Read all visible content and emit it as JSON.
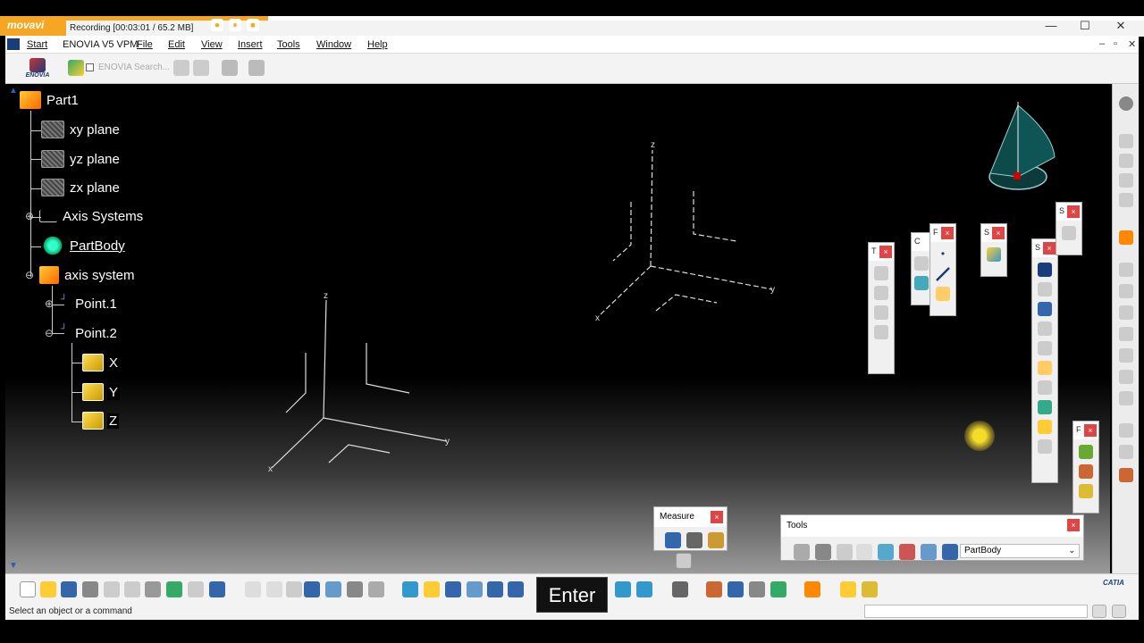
{
  "recording": {
    "logo": "movavi",
    "status": "Recording   [00:03:01 / 65.2 MB]",
    "btn1": "⏺",
    "btn2": "⏸",
    "btn3": "■"
  },
  "window": {
    "minimize": "—",
    "maximize": "☐",
    "close": "✕"
  },
  "menu": {
    "start": "Start",
    "enovia": "ENOVIA V5 VPM",
    "file": "File",
    "edit": "Edit",
    "view": "View",
    "insert": "Insert",
    "tools": "Tools",
    "window": "Window",
    "help": "Help"
  },
  "mdi": {
    "minimize": "–",
    "restore": "▫",
    "close": "✕"
  },
  "toptoolbar": {
    "enovia_logo": "ENOVIA",
    "search_placeholder": "ENOVIA Search..."
  },
  "tree": {
    "root": "Part1",
    "xy": "xy plane",
    "yz": "yz plane",
    "zx": "zx plane",
    "axis_systems": "Axis Systems",
    "partbody": "PartBody",
    "axis_system": "axis system",
    "point1": "Point.1",
    "point2": "Point.2",
    "px": "X",
    "py": "Y",
    "pz": "Z"
  },
  "axes": {
    "z": "z",
    "y": "y",
    "x": "x"
  },
  "palettes": {
    "p1": "T",
    "p2": "C",
    "p3": "F",
    "p4": "S",
    "p5": "S",
    "p6": "S",
    "p7": "F",
    "close": "×"
  },
  "measure": {
    "title": "Measure"
  },
  "tools": {
    "title": "Tools",
    "current": "PartBody"
  },
  "statusbar": {
    "text": "Select an object or a command"
  },
  "overlay": {
    "key": "Enter"
  },
  "catia": {
    "logo": "CATIA"
  }
}
